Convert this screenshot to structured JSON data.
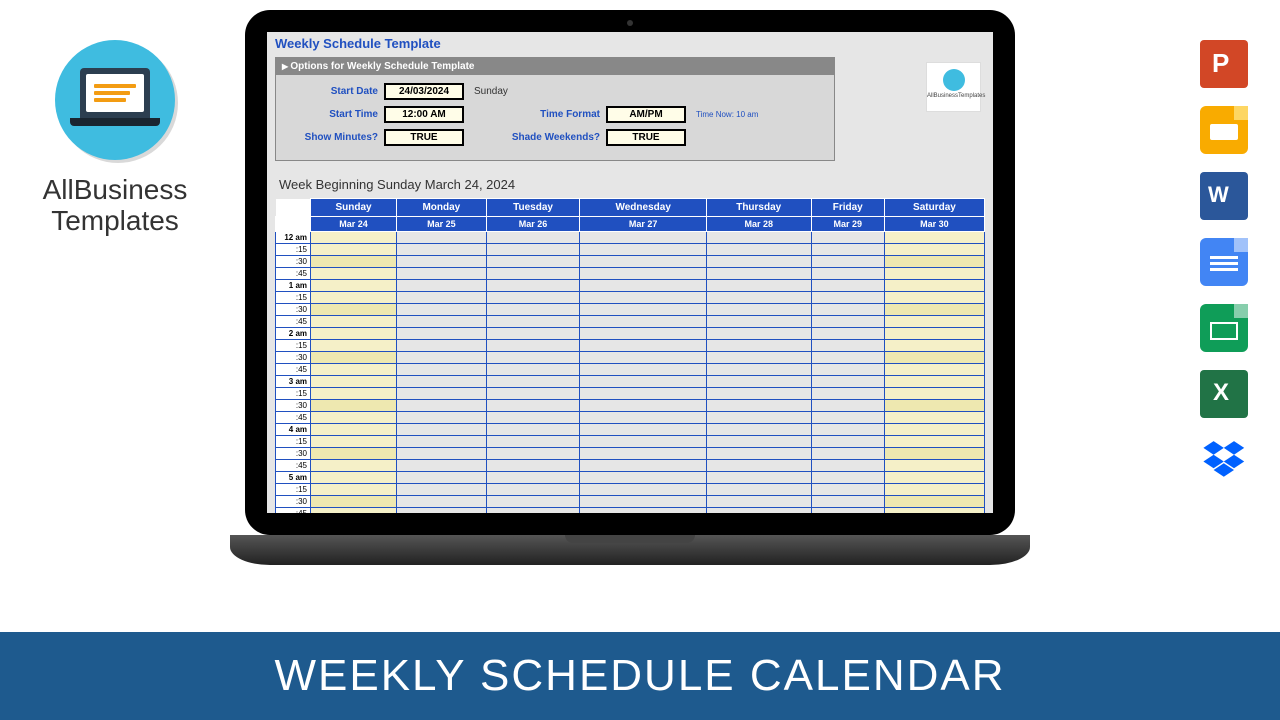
{
  "logo": {
    "line1": "AllBusiness",
    "line2": "Templates"
  },
  "template": {
    "title": "Weekly Schedule Template",
    "options_header": "Options for Weekly Schedule Template",
    "labels": {
      "start_date": "Start Date",
      "start_time": "Start Time",
      "show_minutes": "Show Minutes?",
      "time_format": "Time Format",
      "shade_weekends": "Shade Weekends?"
    },
    "values": {
      "start_date": "24/03/2024",
      "start_date_day": "Sunday",
      "start_time": "12:00 AM",
      "show_minutes": "TRUE",
      "time_format": "AM/PM",
      "time_hint": "Time Now: 10 am",
      "shade_weekends": "TRUE"
    },
    "small_logo_text": "AllBusinessTemplates"
  },
  "schedule": {
    "week_title": "Week Beginning Sunday March 24, 2024",
    "days": [
      "Sunday",
      "Monday",
      "Tuesday",
      "Wednesday",
      "Thursday",
      "Friday",
      "Saturday"
    ],
    "dates": [
      "Mar 24",
      "Mar 25",
      "Mar 26",
      "Mar 27",
      "Mar 28",
      "Mar 29",
      "Mar 30"
    ],
    "hours": [
      "12 am",
      "1 am",
      "2 am",
      "3 am",
      "4 am",
      "5 am"
    ],
    "minutes": [
      ":15",
      ":30",
      ":45"
    ]
  },
  "banner": {
    "text": "WEEKLY SCHEDULE CALENDAR"
  },
  "icons": [
    "powerpoint",
    "google-slides",
    "word",
    "google-docs",
    "google-sheets",
    "excel",
    "dropbox"
  ]
}
